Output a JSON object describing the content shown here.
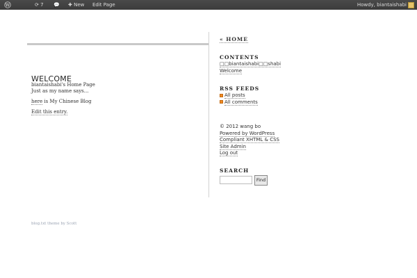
{
  "admin_bar": {
    "updates_count": "7",
    "new_label": "New",
    "edit_label": "Edit Page",
    "howdy": "Howdy, biantaishabi"
  },
  "page": {
    "title": "WELCOME",
    "subtitle": "biantaishabi's Home Page",
    "line1": "Just as my name says...",
    "line2_link": "here",
    "line2_rest": " is My Chinese Blog",
    "edit_link": "Edit this entry."
  },
  "sidebar": {
    "home_link": "« HOME",
    "contents_heading": "CONTENTS",
    "contents_items": [
      "□□biantaishabi□□shabi",
      "Welcome"
    ],
    "rss_heading": "RSS FEEDS",
    "rss_items": [
      "All posts",
      "All comments"
    ],
    "meta_items": [
      "© 2012 wang bo",
      "Powered by WordPress",
      "Compliant XHTML & CSS",
      "Site Admin",
      "Log out"
    ],
    "search_heading": "SEARCH",
    "search_value": "",
    "find_label": "Find"
  },
  "footer": {
    "credit": "blog.txt theme by Scott"
  },
  "colors": {
    "admin_bar_bg": "#464646",
    "rss_orange": "#f08a24",
    "footer_link": "#9aa3b3"
  }
}
